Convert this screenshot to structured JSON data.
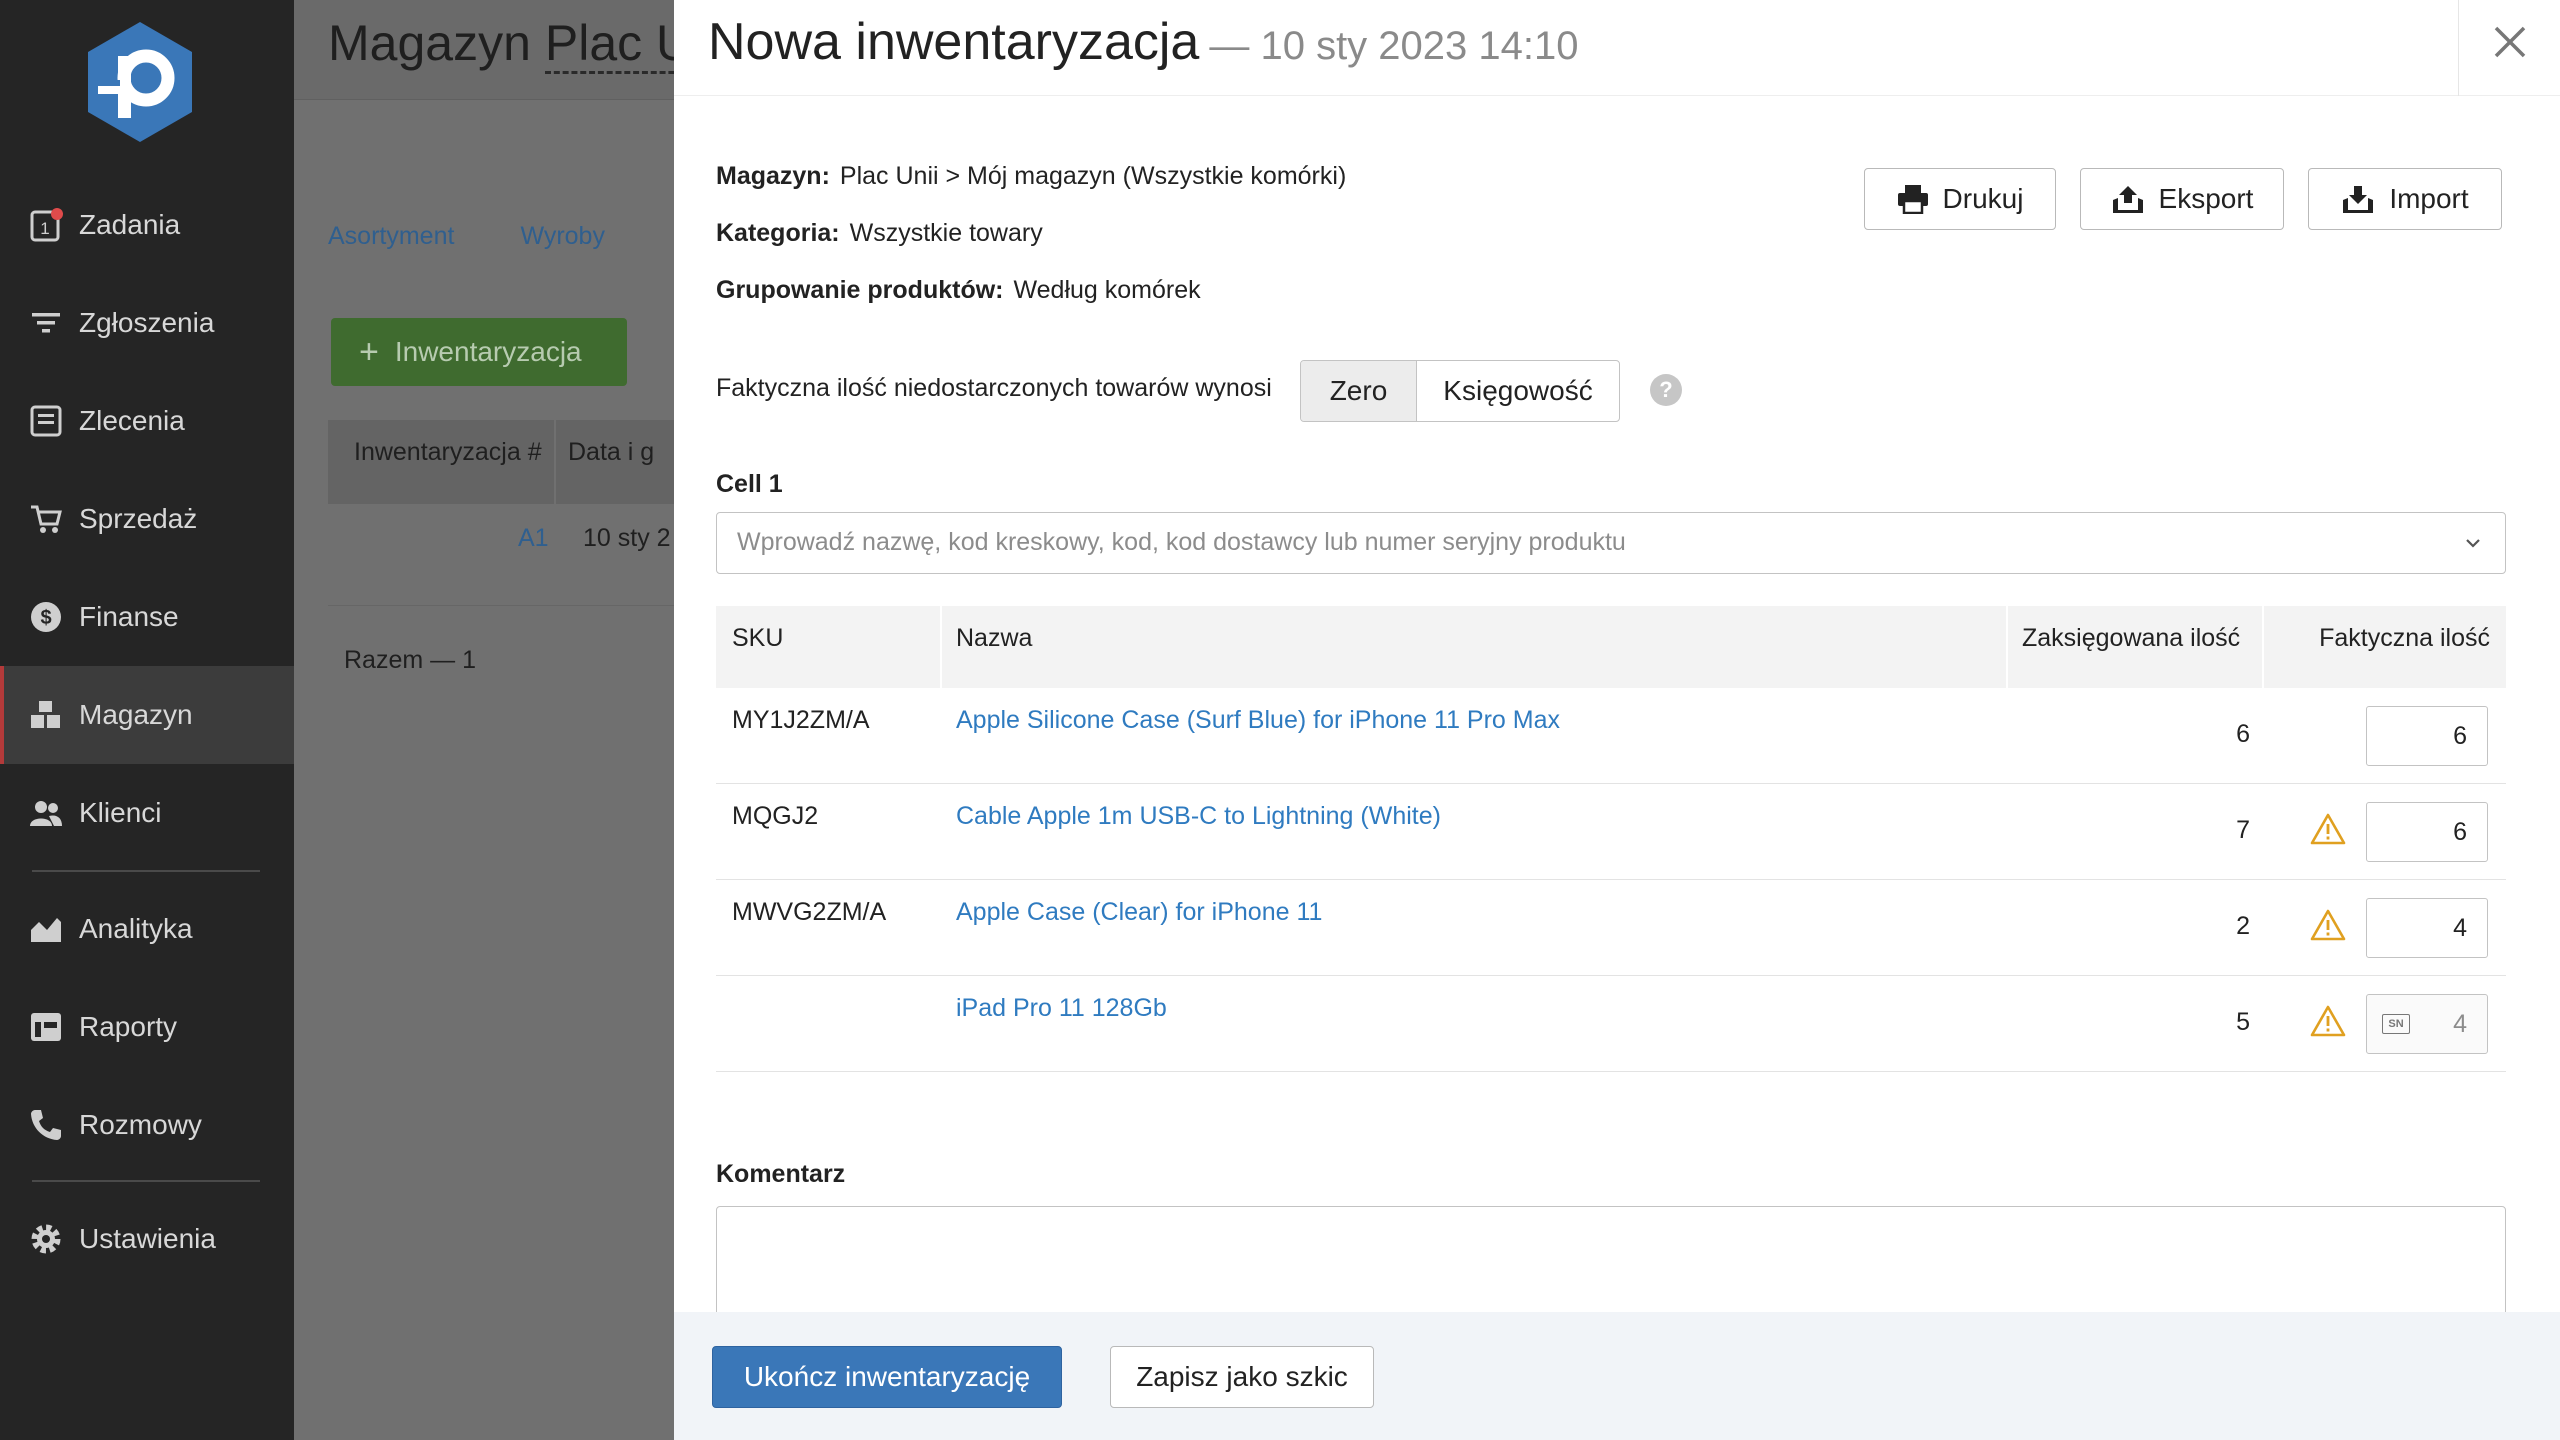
{
  "sidebar": {
    "logo": "p-logo-icon",
    "items": [
      {
        "label": "Zadania",
        "icon": "tasks-icon"
      },
      {
        "label": "Zgłoszenia",
        "icon": "filter-icon"
      },
      {
        "label": "Zlecenia",
        "icon": "orders-icon"
      },
      {
        "label": "Sprzedaż",
        "icon": "cart-icon"
      },
      {
        "label": "Finanse",
        "icon": "dollar-icon"
      },
      {
        "label": "Magazyn",
        "icon": "warehouse-icon",
        "active": true
      },
      {
        "label": "Klienci",
        "icon": "clients-icon"
      },
      {
        "label": "Analityka",
        "icon": "chart-icon"
      },
      {
        "label": "Raporty",
        "icon": "reports-icon"
      },
      {
        "label": "Rozmowy",
        "icon": "phone-icon"
      },
      {
        "label": "Ustawienia",
        "icon": "gear-icon"
      }
    ],
    "badge_color": "#e04b4b"
  },
  "background": {
    "title": "Magazyn",
    "warehouse": "Plac U",
    "tabs": [
      "Asortyment",
      "Wyroby"
    ],
    "add_button": "Inwentaryzacja",
    "table_headers": [
      "Inwentaryzacja #",
      "Data i g"
    ],
    "row": {
      "id": "A1",
      "date": "10 sty 2"
    },
    "total": "Razem — 1"
  },
  "panel": {
    "title": "Nowa inwentaryzacja",
    "date": "— 10 sty 2023 14:10",
    "meta": {
      "warehouse_label": "Magazyn:",
      "warehouse_value": "Plac Unii > Mój magazyn (Wszystkie komórki)",
      "category_label": "Kategoria:",
      "category_value": "Wszystkie towary",
      "grouping_label": "Grupowanie produktów:",
      "grouping_value": "Według komórek"
    },
    "toolbar": {
      "print": "Drukuj",
      "export": "Eksport",
      "import": "Import"
    },
    "qty_label": "Faktyczna ilość niedostarczonych towarów wynosi",
    "segment": [
      "Zero",
      "Księgowość"
    ],
    "segment_selected": "Zero",
    "help": "?",
    "cell_label": "Cell 1",
    "search_placeholder": "Wprowadź nazwę, kod kreskowy, kod, kod dostawcy lub numer seryjny produktu",
    "table": {
      "headers": {
        "sku": "SKU",
        "name": "Nazwa",
        "booked": "Zaksięgowana ilość",
        "actual": "Faktyczna ilość"
      },
      "rows": [
        {
          "sku": "MY1J2ZM/A",
          "name": "Apple Silicone Case (Surf Blue) for iPhone 11 Pro Max",
          "booked": "6",
          "actual": "6",
          "warning": false,
          "serial": false
        },
        {
          "sku": "MQGJ2",
          "name": "Cable Apple 1m USB-C to Lightning (White)",
          "booked": "7",
          "actual": "6",
          "warning": true,
          "serial": false
        },
        {
          "sku": "MWVG2ZM/A",
          "name": "Apple Case (Clear) for iPhone 11",
          "booked": "2",
          "actual": "4",
          "warning": true,
          "serial": false
        },
        {
          "sku": "",
          "name": "iPad Pro 11 128Gb",
          "booked": "5",
          "actual": "4",
          "warning": true,
          "serial": true,
          "serial_label": "SN"
        }
      ]
    },
    "comment_label": "Komentarz",
    "comment_value": "",
    "footer": {
      "finish": "Ukończ inwentaryzację",
      "draft": "Zapisz jako szkic"
    },
    "colors": {
      "accent": "#3a77b8",
      "link": "#2f7bc0",
      "warning": "#e0a020",
      "green": "#4a9a3a"
    }
  }
}
